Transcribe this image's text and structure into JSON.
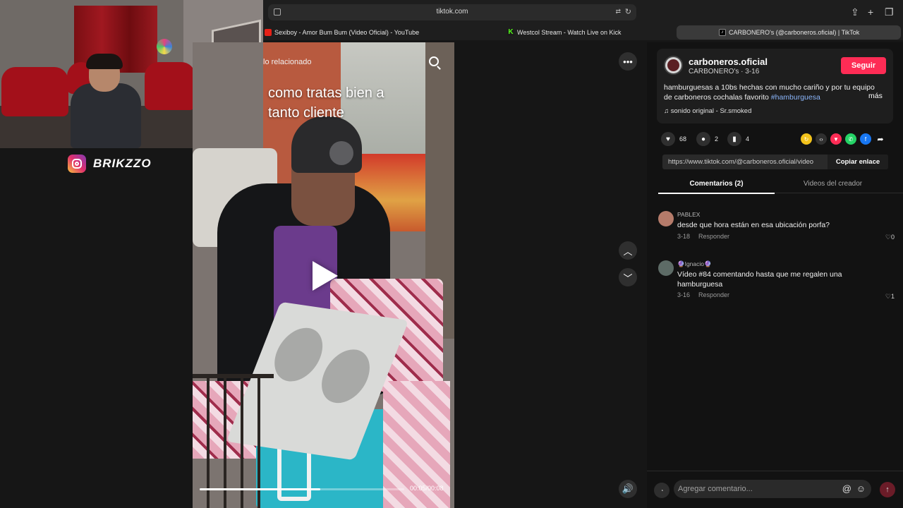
{
  "browser": {
    "url": "tiktok.com",
    "tabs": [
      {
        "label": "Sexiboy - Amor Bum Bum (Video Oficial) - YouTube",
        "favicon": "youtube-icon"
      },
      {
        "label": "Westcol Stream - Watch Live on Kick",
        "favicon": "kick-icon"
      },
      {
        "label": "CARBONERO's (@carboneros.oficial) | TikTok",
        "favicon": "tiktok-icon",
        "active": true
      }
    ]
  },
  "overlay": {
    "instagram_handle": "BRIKZZO"
  },
  "video": {
    "related_label": "lo relacionado",
    "caption": "como tratas bien a tanto cliente",
    "time": "00:05/00:08",
    "progress_fraction": 0.59
  },
  "post": {
    "author": "carboneros.oficial",
    "author_sub": "CARBONERO's · 3-16",
    "follow_label": "Seguir",
    "description": "hamburguesas a 10bs hechas con mucho cariño y por tu equipo de carboneros cochalas favorito ",
    "hashtag": "#hamburguesa",
    "more_label": "más",
    "sound": "sonido original - Sr.smoked",
    "likes": "68",
    "comments": "2",
    "saves": "4",
    "link": "https://www.tiktok.com/@carboneros.oficial/video",
    "copy_label": "Copiar enlace"
  },
  "tabs": {
    "comments": "Comentarios (2)",
    "creator_videos": "Videos del creador"
  },
  "comments": [
    {
      "user": "PABLEX",
      "text": "desde que hora están en esa ubicación porfa?",
      "date": "3-18",
      "reply": "Responder",
      "likes": "0"
    },
    {
      "user": "🔮Ignacio🔮",
      "text": "Vídeo #84 comentando hasta que me regalen una hamburguesa",
      "date": "3-16",
      "reply": "Responder",
      "likes": "1"
    }
  ],
  "comment_input": {
    "placeholder": "Agregar comentario..."
  },
  "colors": {
    "accent": "#fe2c55",
    "hashtag": "#8ab4f8"
  }
}
